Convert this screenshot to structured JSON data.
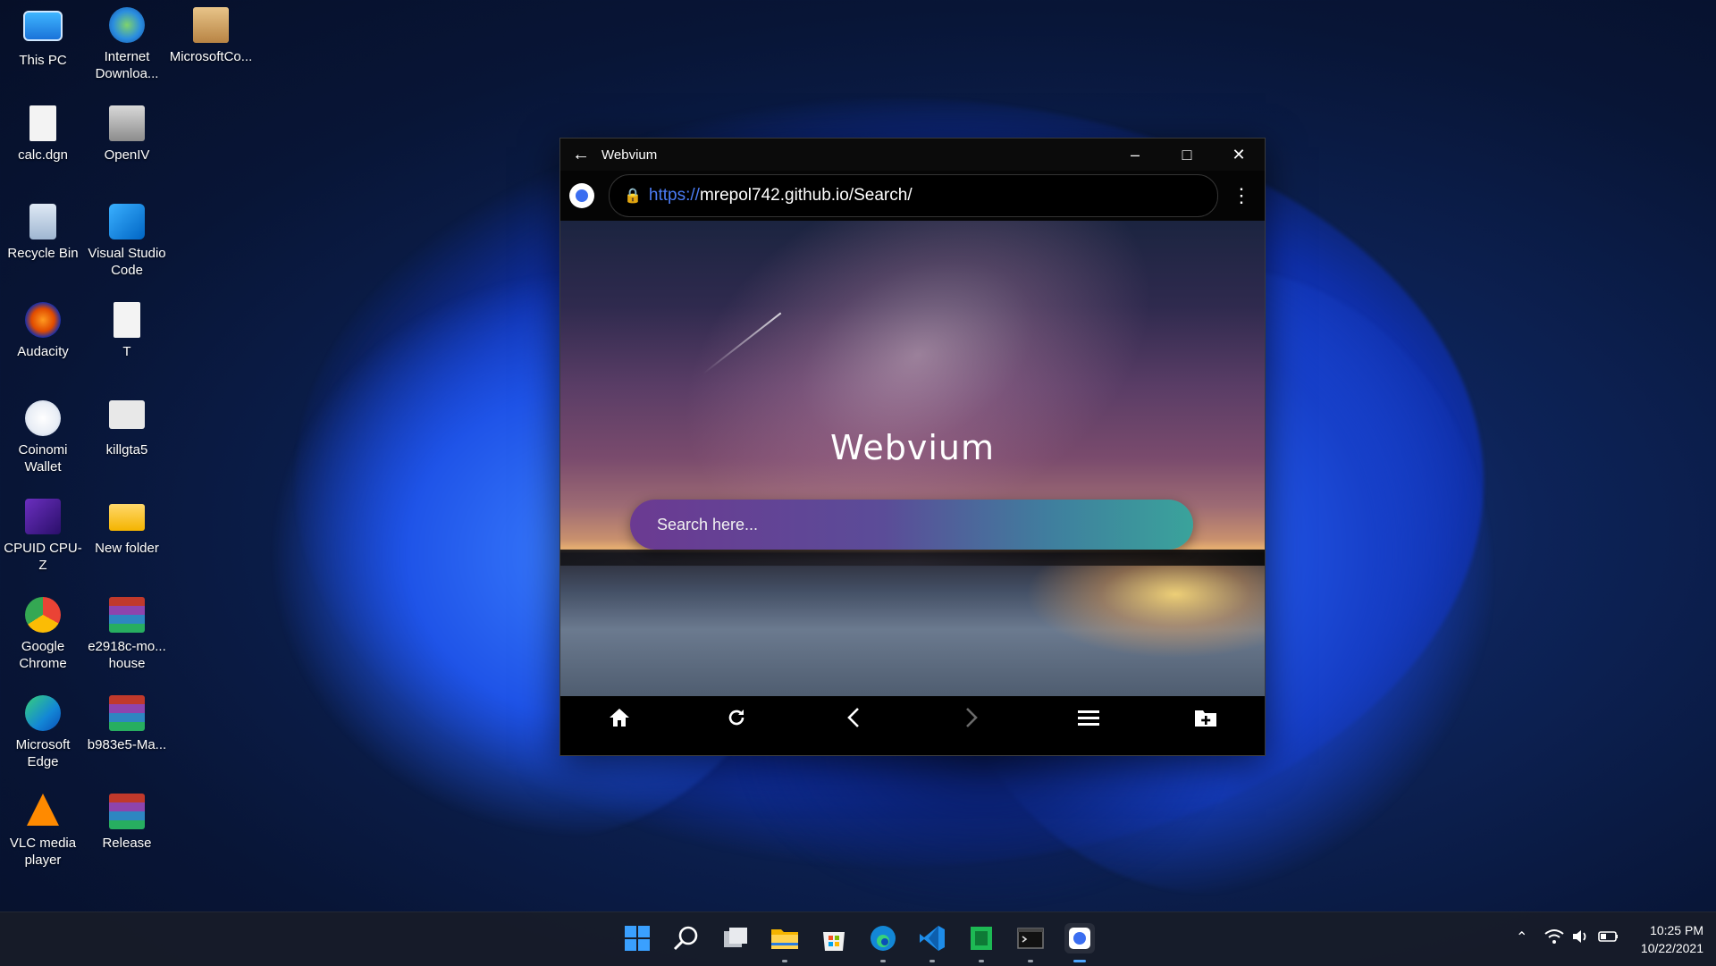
{
  "desktop": {
    "icons": [
      {
        "label": "This PC"
      },
      {
        "label": "Internet Downloa..."
      },
      {
        "label": "MicrosoftCo..."
      },
      {
        "label": "calc.dgn"
      },
      {
        "label": "OpenIV"
      },
      {
        "label": "Recycle Bin"
      },
      {
        "label": "Visual Studio Code"
      },
      {
        "label": "Audacity"
      },
      {
        "label": "T"
      },
      {
        "label": "Coinomi Wallet"
      },
      {
        "label": "killgta5"
      },
      {
        "label": "CPUID CPU-Z"
      },
      {
        "label": "New folder"
      },
      {
        "label": "Google Chrome"
      },
      {
        "label": "e2918c-mo... house"
      },
      {
        "label": "Microsoft Edge"
      },
      {
        "label": "b983e5-Ma..."
      },
      {
        "label": "VLC media player"
      },
      {
        "label": "Release"
      }
    ]
  },
  "window": {
    "title": "Webvium",
    "url_scheme": "https://",
    "url_rest": "mrepol742.github.io/Search/",
    "brand": "Webvium",
    "search_placeholder": "Search here..."
  },
  "taskbar": {
    "time": "10:25 PM",
    "date": "10/22/2021"
  }
}
